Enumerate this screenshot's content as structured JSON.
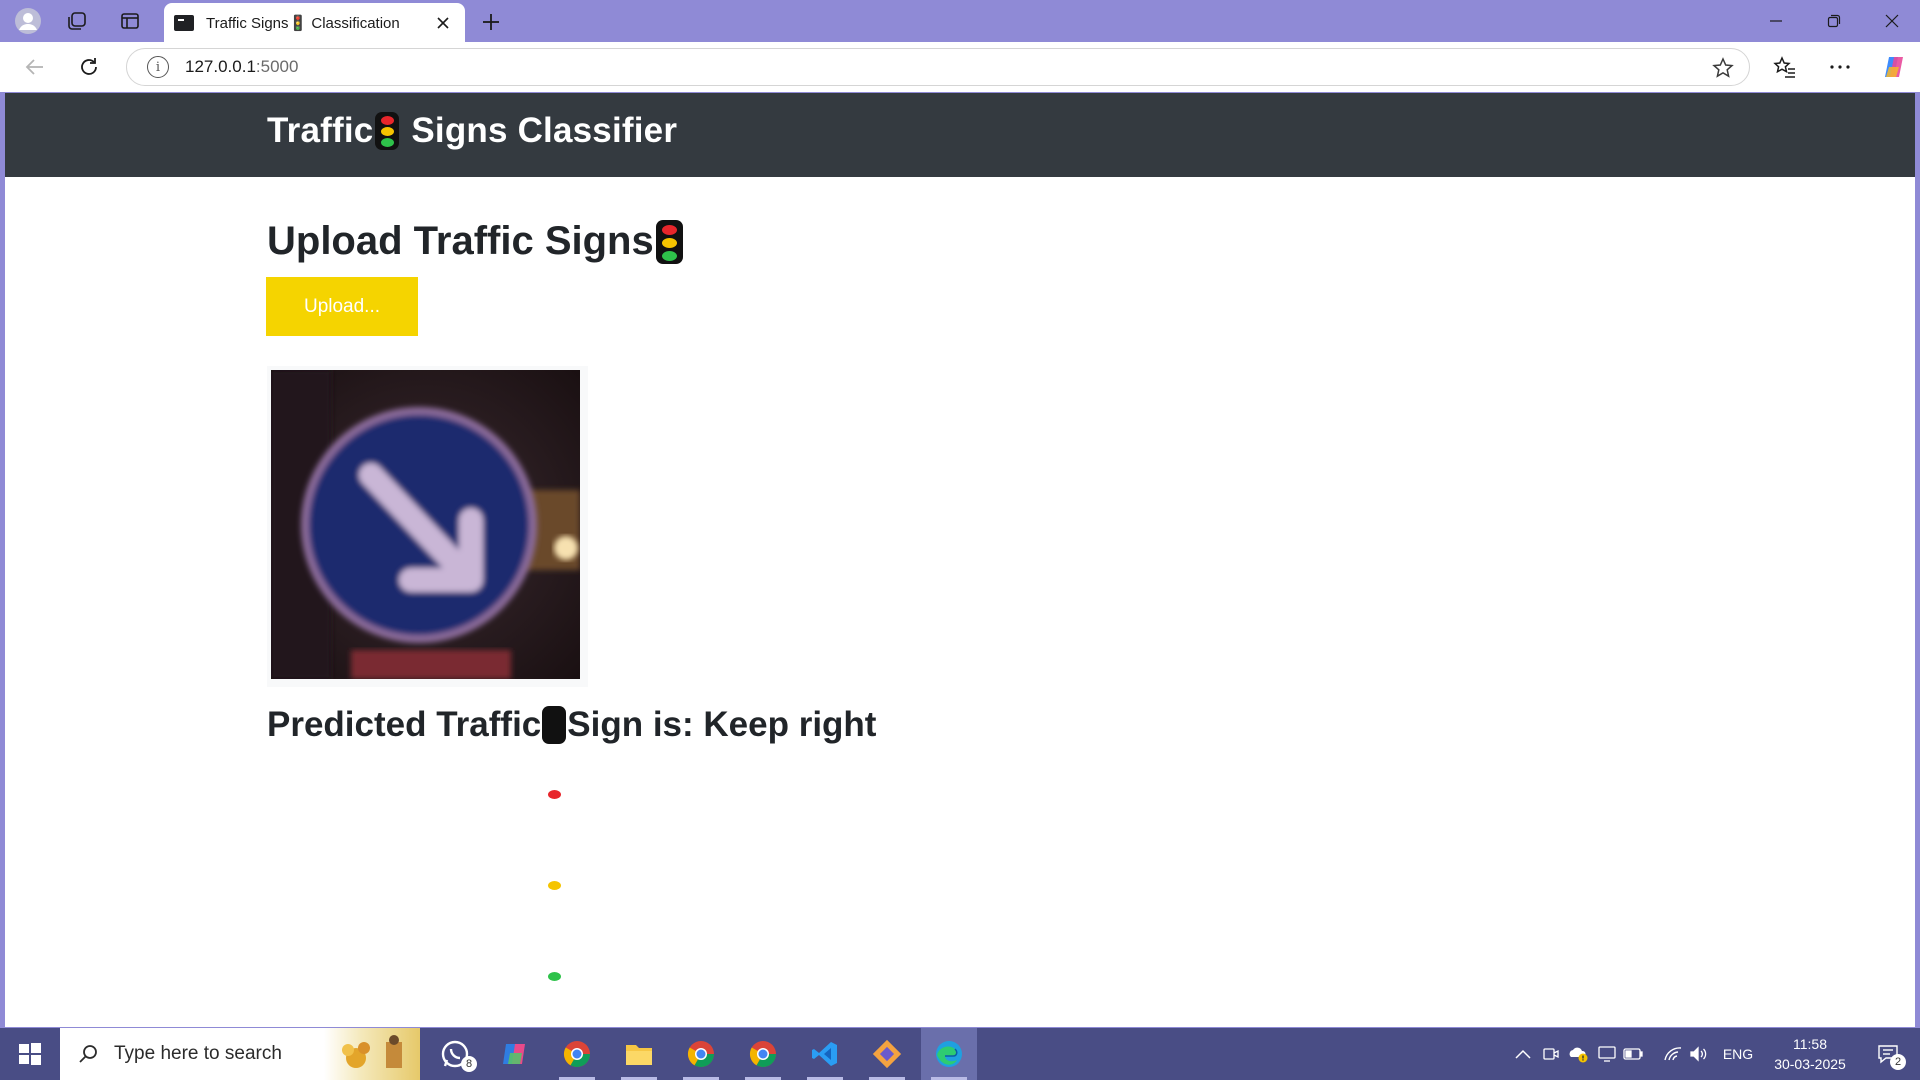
{
  "browser": {
    "tab": {
      "title": "Traffic Signs🚦 Classification"
    },
    "address": {
      "host": "127.0.0.1",
      "port": ":5000"
    },
    "theme_color": "#8f8ad6"
  },
  "page": {
    "brand_before": "Traffic",
    "brand_after": " Signs Classifier",
    "heading": "Upload Traffic Signs",
    "upload_button": "Upload...",
    "prediction_before": "Predicted Traffic",
    "prediction_after": "Sign is: Keep right",
    "header_color": "#343a40",
    "button_color": "#f5d400"
  },
  "taskbar": {
    "search_placeholder": "Type here to search",
    "whatsapp_badge": "8",
    "language": "ENG",
    "time": "11:58",
    "date": "30-03-2025",
    "notifications": "2",
    "icons": [
      "whatsapp-icon",
      "m365-icon",
      "chrome-profile-icon",
      "file-explorer-icon",
      "chrome-h-icon",
      "chrome-h2-icon",
      "vscode-icon",
      "git-icon",
      "edge-icon"
    ]
  }
}
